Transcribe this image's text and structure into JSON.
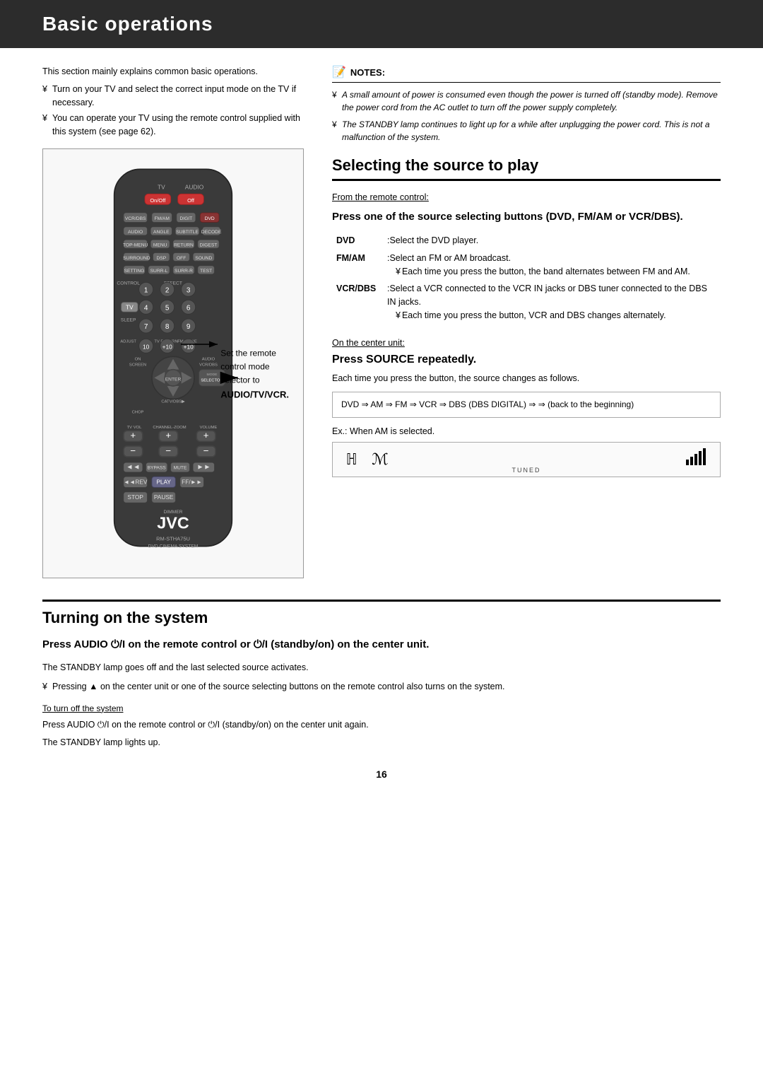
{
  "header": {
    "title": "Basic operations"
  },
  "intro": {
    "description": "This section mainly explains common basic operations.",
    "bullets": [
      "Turn on your TV and select the correct input mode on the TV if necessary.",
      "You can operate your TV using the remote control supplied with this system (see page 62)."
    ]
  },
  "notes": {
    "header": "NOTES:",
    "items": [
      "A small amount of power is consumed even though the power is turned off (standby mode). Remove the power cord from the AC outlet to turn off the power supply completely.",
      "The STANDBY lamp continues to light up for a while after unplugging the power cord. This is not a malfunction of the system."
    ]
  },
  "remote_callout": {
    "line1": "Set the remote",
    "line2": "control mode",
    "line3": "selector to",
    "line4": "AUDIO/TV/VCR."
  },
  "selecting_section": {
    "title": "Selecting the source to play",
    "from_remote_label": "From the remote control:",
    "subsection_title": "Press one of the source selecting buttons (DVD, FM/AM or VCR/DBS).",
    "sources": [
      {
        "name": "DVD",
        "desc": ":Select the DVD player."
      },
      {
        "name": "FM/AM",
        "desc": ":Select an FM or AM broadcast.",
        "sub": "Each time you press the button, the band alternates between FM and AM."
      },
      {
        "name": "VCR/DBS",
        "desc": ":Select a VCR connected to the VCR IN jacks or DBS tuner connected to the DBS IN jacks.",
        "sub": "Each time you press the button, VCR and DBS changes alternately."
      }
    ],
    "on_center_label": "On the center unit:",
    "press_source_title": "Press SOURCE repeatedly.",
    "press_source_desc": "Each time you press the button, the source changes as follows.",
    "dvd_sequence": "DVD ⇒ AM ⇒ FM ⇒ VCR ⇒ DBS (DBS DIGITAL) ⇒ ⇒ (back to the beginning)",
    "example_text": "Ex.: When  AM  is selected.",
    "am_display_chars": "ℍ  ℳ",
    "tuned_label": "TUNED"
  },
  "turning_on_section": {
    "title": "Turning on the system",
    "press_audio_title": "Press AUDIO ⏻/I on the remote control or ⏻/I (standby/on) on the center unit.",
    "standby_desc": "The STANDBY lamp goes off and the last selected source activates.",
    "bullets": [
      "Pressing ▲ on the center unit or one of the source selecting buttons on the remote control also turns on the system."
    ],
    "turn_off_label": "To turn off the system",
    "press_audio_off": "Press AUDIO ⏻/I on the remote control or ⏻/I (standby/on) on the center unit again.",
    "standby_lamp_text": "The STANDBY lamp lights up."
  },
  "page_number": "16"
}
